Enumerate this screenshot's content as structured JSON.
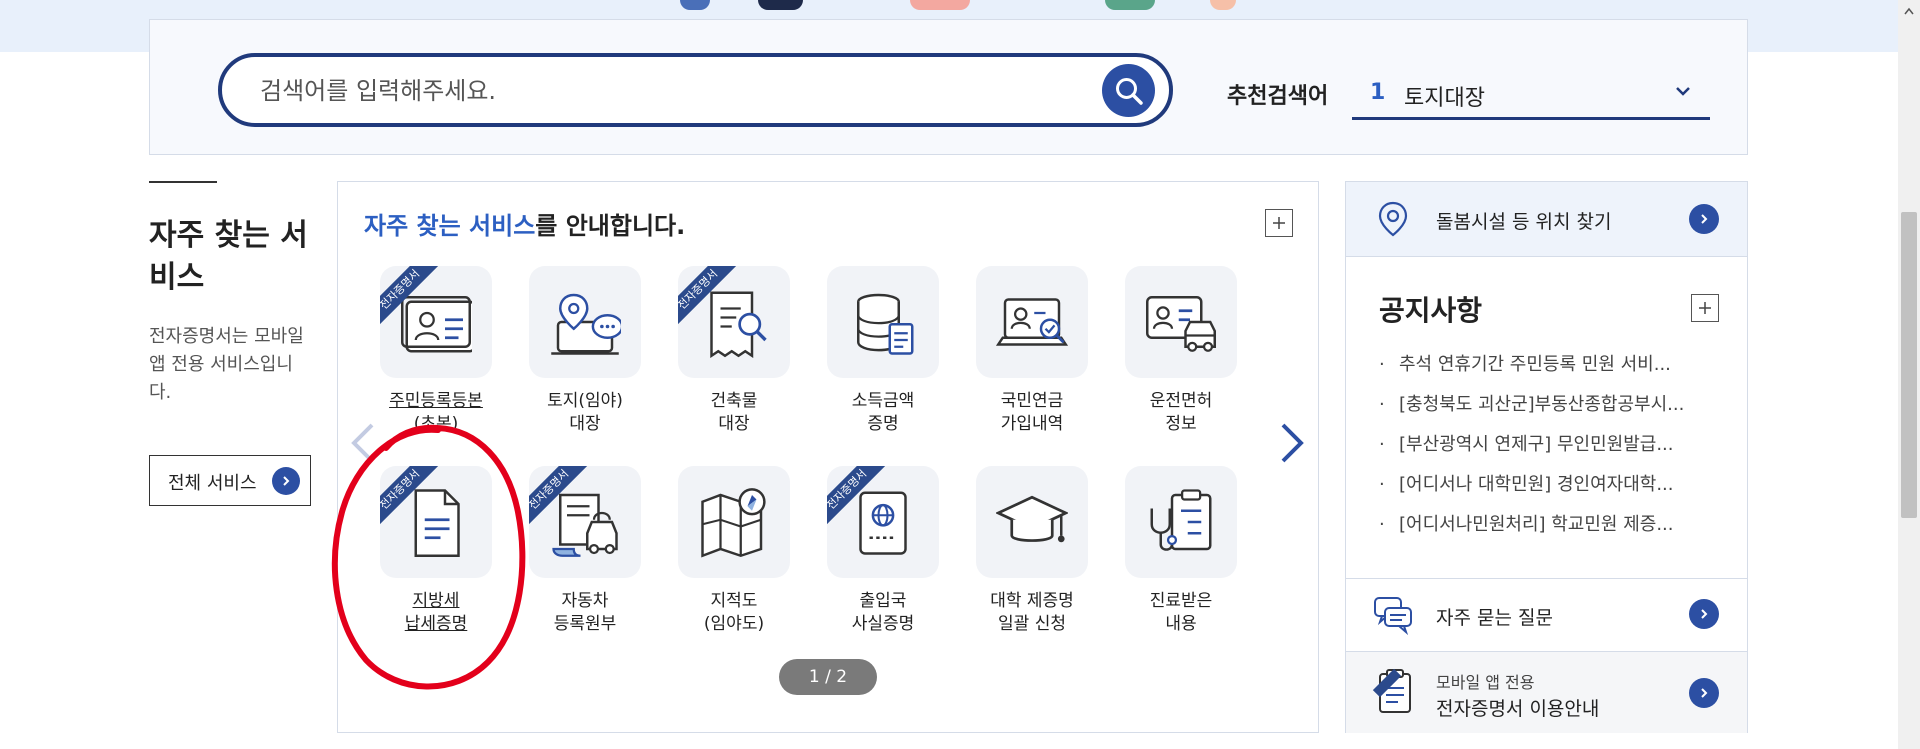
{
  "search": {
    "placeholder": "검색어를 입력해주세요.",
    "recommended_label": "추천검색어",
    "recommended_rank": "1",
    "recommended_value": "토지대장"
  },
  "intro": {
    "title": "자주 찾는 서비스",
    "description": "전자증명서는 모바일 앱 전용 서비스입니다.",
    "all_services_label": "전체 서비스"
  },
  "services": {
    "heading_highlight": "자주 찾는 서비스",
    "heading_rest": "를 안내합니다.",
    "ribbon_text": "전자증명서",
    "pager": "1 / 2",
    "items": [
      {
        "line1": "주민등록등본",
        "line2": "(초본)",
        "ribbon": true,
        "icon": "id-card-icon"
      },
      {
        "line1": "토지(임야)",
        "line2": "대장",
        "ribbon": false,
        "icon": "land-location-icon"
      },
      {
        "line1": "건축물",
        "line2": "대장",
        "ribbon": true,
        "icon": "building-document-icon"
      },
      {
        "line1": "소득금액",
        "line2": "증명",
        "ribbon": false,
        "icon": "income-database-icon"
      },
      {
        "line1": "국민연금",
        "line2": "가입내역",
        "ribbon": false,
        "icon": "pension-laptop-icon"
      },
      {
        "line1": "운전면허",
        "line2": "정보",
        "ribbon": false,
        "icon": "drivers-license-icon"
      },
      {
        "line1": "지방세",
        "line2": "납세증명",
        "ribbon": true,
        "icon": "tax-document-icon"
      },
      {
        "line1": "자동차",
        "line2": "등록원부",
        "ribbon": true,
        "icon": "car-registration-icon"
      },
      {
        "line1": "지적도",
        "line2": "(임야도)",
        "ribbon": false,
        "icon": "cadastral-map-icon"
      },
      {
        "line1": "출입국",
        "line2": "사실증명",
        "ribbon": true,
        "icon": "passport-icon"
      },
      {
        "line1": "대학 제증명",
        "line2": "일괄 신청",
        "ribbon": false,
        "icon": "graduation-cap-icon"
      },
      {
        "line1": "진료받은",
        "line2": "내용",
        "ribbon": false,
        "icon": "medical-record-icon"
      }
    ]
  },
  "right": {
    "location_label": "돌봄시설 등 위치 찾기",
    "notice_title": "공지사항",
    "notices": [
      "추석 연휴기간 주민등록 민원 서비...",
      "[충청북도 괴산군]부동산종합공부시...",
      "[부산광역시 연제구] 무인민원발급...",
      "[어디서나 대학민원] 경인여자대학...",
      "[어디서나민원처리] 학교민원 제증..."
    ],
    "faq_label": "자주 묻는 질문",
    "app_sub": "모바일 앱 전용",
    "app_label": "전자증명서 이용안내"
  },
  "colors": {
    "brand": "#203a7c",
    "accent": "#2c4fa3",
    "highlight": "#2c5fc2",
    "annotation": "#e3001b"
  }
}
